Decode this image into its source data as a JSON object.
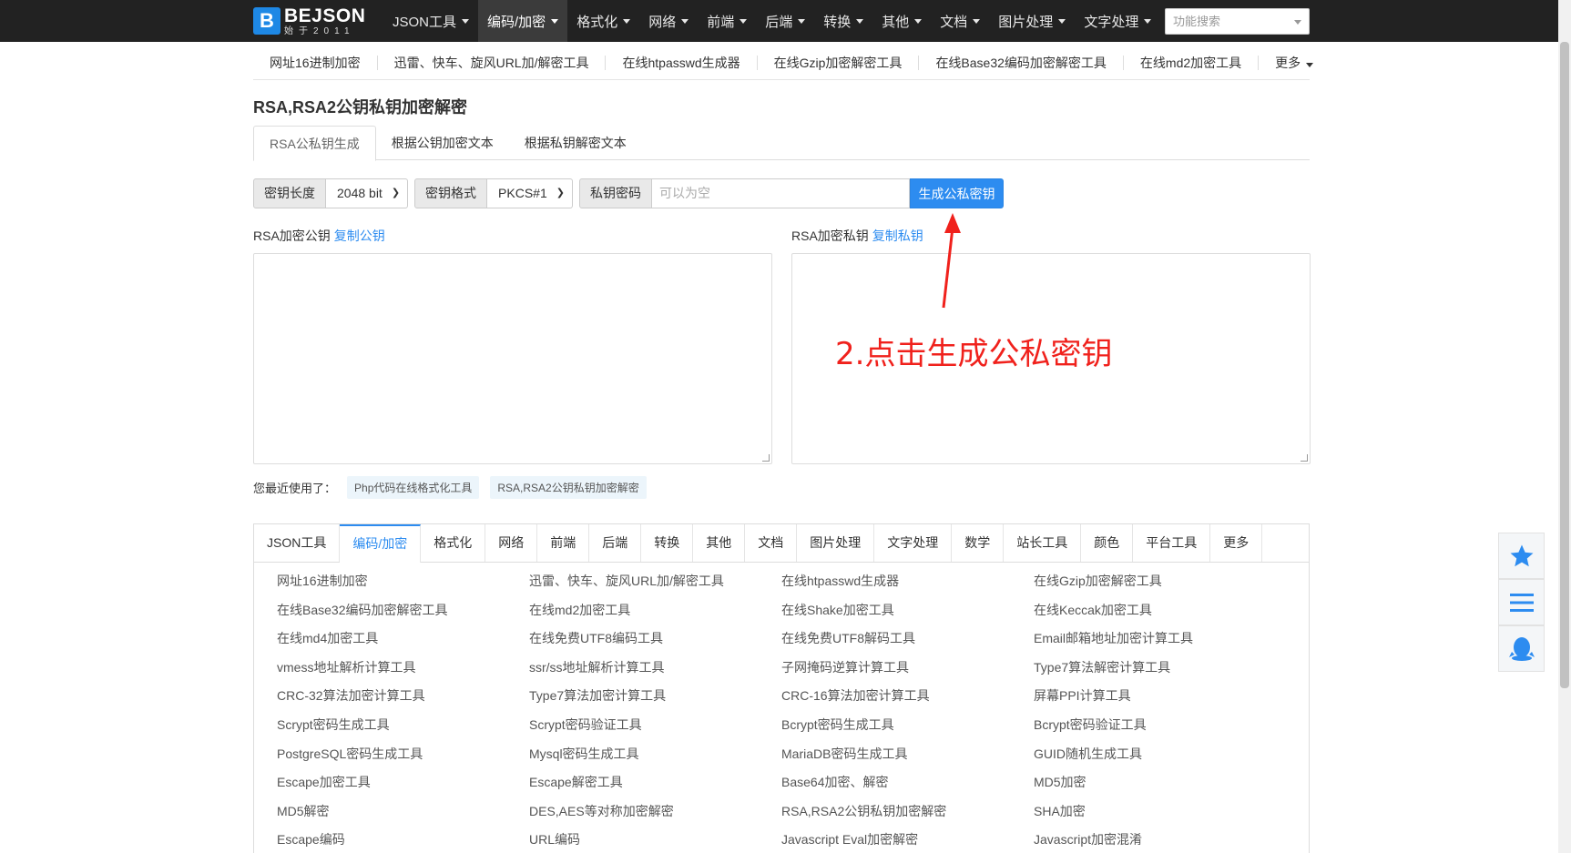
{
  "logo": {
    "mark": "B",
    "name": "BEJSON",
    "sub": "始于2011"
  },
  "nav": [
    {
      "label": "JSON工具",
      "active": false
    },
    {
      "label": "编码/加密",
      "active": true
    },
    {
      "label": "格式化",
      "active": false
    },
    {
      "label": "网络",
      "active": false
    },
    {
      "label": "前端",
      "active": false
    },
    {
      "label": "后端",
      "active": false
    },
    {
      "label": "转换",
      "active": false
    },
    {
      "label": "其他",
      "active": false
    },
    {
      "label": "文档",
      "active": false
    },
    {
      "label": "图片处理",
      "active": false
    },
    {
      "label": "文字处理",
      "active": false
    }
  ],
  "search": {
    "placeholder": "功能搜索"
  },
  "quick_links": [
    "网址16进制加密",
    "迅雷、快车、旋风URL加/解密工具",
    "在线htpasswd生成器",
    "在线Gzip加密解密工具",
    "在线Base32编码加密解密工具",
    "在线md2加密工具"
  ],
  "quick_more": "更多",
  "page_title": "RSA,RSA2公钥私钥加密解密",
  "tabs": [
    "RSA公私钥生成",
    "根据公钥加密文本",
    "根据私钥解密文本"
  ],
  "form": {
    "key_length_label": "密钥长度",
    "key_length_value": "2048 bit",
    "key_format_label": "密钥格式",
    "key_format_value": "PKCS#1",
    "private_pwd_label": "私钥密码",
    "private_pwd_placeholder": "可以为空",
    "generate_label": "生成公私密钥"
  },
  "public_key": {
    "label": "RSA加密公钥",
    "copy": "复制公钥",
    "value": ""
  },
  "private_key": {
    "label": "RSA加密私钥",
    "copy": "复制私钥",
    "value": ""
  },
  "annotation": {
    "text": "2.点击生成公私密钥",
    "color": "#f0211c"
  },
  "recent": {
    "label": "您最近使用了：",
    "items": [
      "Php代码在线格式化工具",
      "RSA,RSA2公钥私钥加密解密"
    ]
  },
  "categories": {
    "tabs": [
      "JSON工具",
      "编码/加密",
      "格式化",
      "网络",
      "前端",
      "后端",
      "转换",
      "其他",
      "文档",
      "图片处理",
      "文字处理",
      "数学",
      "站长工具",
      "颜色",
      "平台工具",
      "更多"
    ],
    "active_index": 1,
    "links": [
      "网址16进制加密",
      "迅雷、快车、旋风URL加/解密工具",
      "在线htpasswd生成器",
      "在线Gzip加密解密工具",
      "在线Base32编码加密解密工具",
      "在线md2加密工具",
      "在线Shake加密工具",
      "在线Keccak加密工具",
      "在线md4加密工具",
      "在线免费UTF8编码工具",
      "在线免费UTF8解码工具",
      "Email邮箱地址加密计算工具",
      "vmess地址解析计算工具",
      "ssr/ss地址解析计算工具",
      "子网掩码逆算计算工具",
      "Type7算法解密计算工具",
      "CRC-32算法加密计算工具",
      "Type7算法加密计算工具",
      "CRC-16算法加密计算工具",
      "屏幕PPI计算工具",
      "Scrypt密码生成工具",
      "Scrypt密码验证工具",
      "Bcrypt密码生成工具",
      "Bcrypt密码验证工具",
      "PostgreSQL密码生成工具",
      "Mysql密码生成工具",
      "MariaDB密码生成工具",
      "GUID随机生成工具",
      "Escape加密工具",
      "Escape解密工具",
      "Base64加密、解密",
      "MD5加密",
      "MD5解密",
      "DES,AES等对称加密解密",
      "RSA,RSA2公钥私钥加密解密",
      "SHA加密",
      "Escape编码",
      "URL编码",
      "Javascript Eval加密解密",
      "Javascript加密混淆"
    ]
  },
  "side_buttons": [
    "star-icon",
    "menu-icon",
    "qq-icon"
  ],
  "colors": {
    "accent": "#2d8cf0",
    "navbar": "#222222",
    "annotation": "#f0211c"
  }
}
